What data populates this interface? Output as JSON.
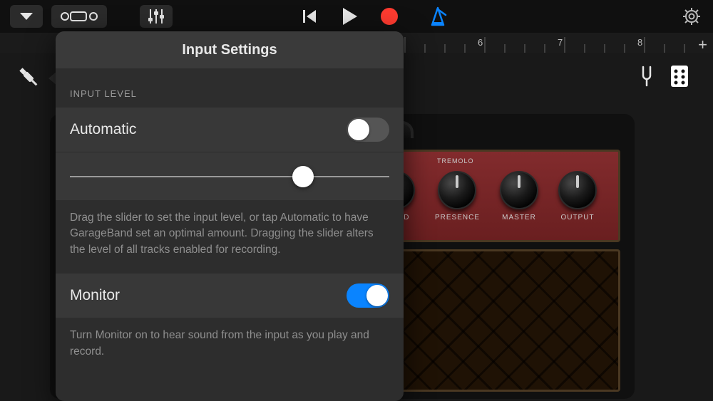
{
  "toolbar": {
    "metronome_color": "#0a84ff",
    "record_color": "#ff3b30"
  },
  "ruler": {
    "numbers": [
      "6",
      "7",
      "8"
    ]
  },
  "amp": {
    "tremolo": "TREMOLO",
    "knobs": [
      "SPEED",
      "PRESENCE",
      "MASTER",
      "OUTPUT"
    ]
  },
  "popover": {
    "title": "Input Settings",
    "input_level_label": "INPUT LEVEL",
    "automatic_label": "Automatic",
    "automatic_on": false,
    "slider_value": 0.73,
    "help1": "Drag the slider to set the input level, or tap Automatic to have GarageBand set an optimal amount. Dragging the slider alters the level of all tracks enabled for recording.",
    "monitor_label": "Monitor",
    "monitor_on": true,
    "help2": "Turn Monitor on to hear sound from the input as you play and record."
  }
}
